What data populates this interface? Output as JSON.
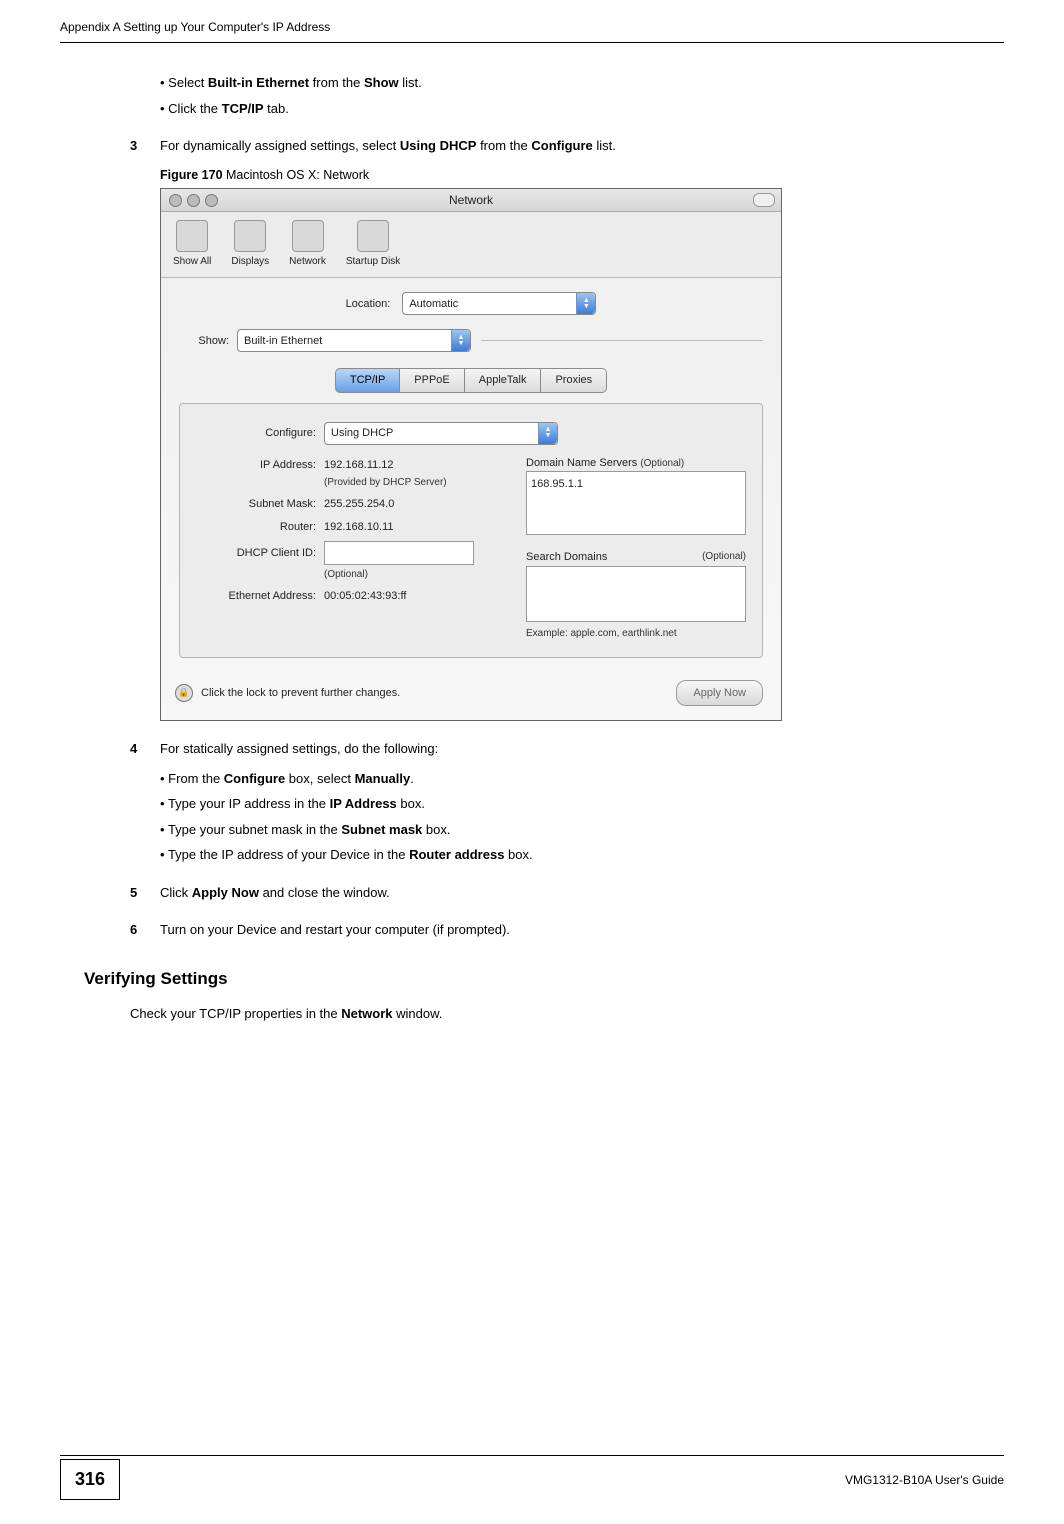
{
  "running_head": "Appendix A Setting up Your Computer's IP Address",
  "top_bullets": {
    "b1_pre": "Select ",
    "b1_bold1": "Built-in Ethernet",
    "b1_mid": " from the ",
    "b1_bold2": "Show",
    "b1_post": " list.",
    "b2_pre": "Click the ",
    "b2_bold": "TCP/IP",
    "b2_post": " tab."
  },
  "step3": {
    "num": "3",
    "pre": "For dynamically assigned settings, select ",
    "bold1": "Using DHCP",
    "mid": " from the ",
    "bold2": "Configure",
    "post": " list."
  },
  "figure": {
    "label": "Figure 170",
    "caption": "   Macintosh OS X: Network"
  },
  "mac": {
    "window_title": "Network",
    "toolbar": {
      "show_all": "Show All",
      "displays": "Displays",
      "network": "Network",
      "startup_disk": "Startup Disk"
    },
    "location_label": "Location:",
    "location_value": "Automatic",
    "show_label": "Show:",
    "show_value": "Built-in Ethernet",
    "tabs": {
      "tcpip": "TCP/IP",
      "pppoe": "PPPoE",
      "appletalk": "AppleTalk",
      "proxies": "Proxies"
    },
    "configure_label": "Configure:",
    "configure_value": "Using DHCP",
    "ip_label": "IP Address:",
    "ip_value": "192.168.11.12",
    "ip_note": "(Provided by DHCP Server)",
    "subnet_label": "Subnet Mask:",
    "subnet_value": "255.255.254.0",
    "router_label": "Router:",
    "router_value": "192.168.10.11",
    "dhcp_label": "DHCP Client ID:",
    "dhcp_note": "(Optional)",
    "ether_label": "Ethernet Address:",
    "ether_value": "00:05:02:43:93:ff",
    "dns_label": "Domain Name Servers",
    "dns_opt": "(Optional)",
    "dns_value": "168.95.1.1",
    "search_label": "Search Domains",
    "search_opt": "(Optional)",
    "example": "Example: apple.com, earthlink.net",
    "lock_text": "Click the lock to prevent further changes.",
    "apply_now": "Apply Now"
  },
  "step4": {
    "num": "4",
    "text": "For statically assigned settings, do the following:",
    "b1_pre": "From the ",
    "b1_bold": "Configure",
    "b1_mid": " box, select ",
    "b1_bold2": "Manually",
    "b1_post": ".",
    "b2_pre": "Type your IP address in the ",
    "b2_bold": "IP Address",
    "b2_post": " box.",
    "b3_pre": "Type your subnet mask in the ",
    "b3_bold": "Subnet mask",
    "b3_post": " box.",
    "b4_pre": "Type the IP address of your Device in the ",
    "b4_bold": "Router address",
    "b4_post": " box."
  },
  "step5": {
    "num": "5",
    "pre": "Click ",
    "bold": "Apply Now",
    "post": " and close the window."
  },
  "step6": {
    "num": "6",
    "text": "Turn on your Device and restart your computer (if prompted)."
  },
  "verifying_h": "Verifying Settings",
  "verifying_p_pre": "Check your TCP/IP properties in the ",
  "verifying_p_bold": "Network",
  "verifying_p_post": " window.",
  "page_number": "316",
  "guide_name": "VMG1312-B10A User's Guide"
}
